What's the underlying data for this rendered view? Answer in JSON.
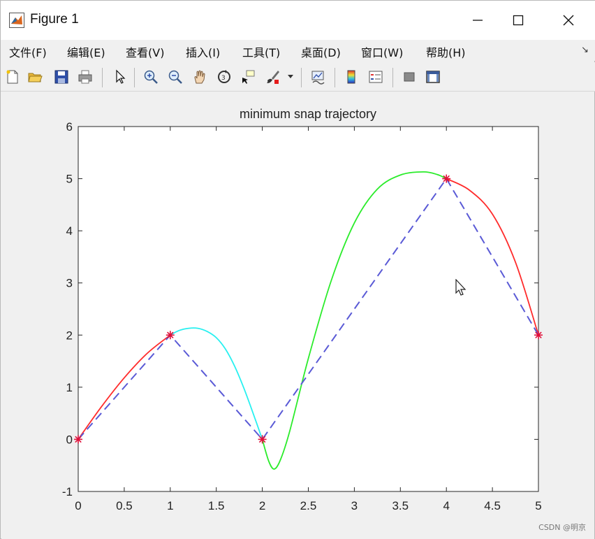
{
  "window": {
    "title": "Figure 1",
    "minimize_icon": "minimize-icon",
    "maximize_icon": "maximize-icon",
    "close_icon": "close-icon"
  },
  "menubar": {
    "items": [
      "文件(F)",
      "编辑(E)",
      "查看(V)",
      "插入(I)",
      "工具(T)",
      "桌面(D)",
      "窗口(W)",
      "帮助(H)"
    ],
    "dock_arrow": "↘"
  },
  "toolbar": {
    "buttons": [
      "new-figure-icon",
      "open-file-icon",
      "save-icon",
      "print-icon",
      "pointer-icon",
      "zoom-in-icon",
      "zoom-out-icon",
      "pan-hand-icon",
      "rotate-3d-icon",
      "data-cursor-icon",
      "brush-icon",
      "brush-dropdown-icon",
      "link-plot-icon",
      "colorbar-icon",
      "legend-icon",
      "hide-plot-tools-icon",
      "show-plot-tools-icon"
    ]
  },
  "colors": {
    "red_segment": "#ff2b2b",
    "cyan_segment": "#28f0f0",
    "green_segment": "#2bec2b",
    "dashed_line": "#5a5ad6",
    "waypoint_marker": "#e0103a"
  },
  "chart_data": {
    "type": "line",
    "title": "minimum snap trajectory",
    "xlim": [
      0,
      5
    ],
    "ylim": [
      -1,
      6
    ],
    "xticks": [
      "0",
      "0.5",
      "1",
      "1.5",
      "2",
      "2.5",
      "3",
      "3.5",
      "4",
      "4.5",
      "5"
    ],
    "yticks": [
      "-1",
      "0",
      "1",
      "2",
      "3",
      "4",
      "5",
      "6"
    ],
    "grid": false,
    "waypoints": {
      "x": [
        0,
        1,
        2,
        4,
        5
      ],
      "y": [
        0,
        2,
        0,
        5,
        2
      ]
    },
    "series": [
      {
        "color": "#ff2b2b",
        "style": "solid",
        "x": [
          0,
          0.25,
          0.5,
          0.75,
          1.0
        ],
        "y": [
          0,
          0.62,
          1.18,
          1.65,
          2.0
        ]
      },
      {
        "color": "#28f0f0",
        "style": "solid",
        "x": [
          1.0,
          1.1,
          1.2,
          1.3,
          1.4,
          1.5,
          1.6,
          1.7,
          1.8,
          1.9,
          2.0
        ],
        "y": [
          2.0,
          2.09,
          2.13,
          2.13,
          2.07,
          1.95,
          1.73,
          1.4,
          0.98,
          0.5,
          0.0
        ]
      },
      {
        "color": "#2bec2b",
        "style": "solid",
        "x": [
          2.0,
          2.07,
          2.13,
          2.2,
          2.3,
          2.5,
          2.75,
          3.0,
          3.25,
          3.5,
          3.75,
          3.9,
          4.0
        ],
        "y": [
          0.0,
          -0.42,
          -0.57,
          -0.38,
          0.17,
          1.55,
          3.05,
          4.15,
          4.8,
          5.07,
          5.13,
          5.08,
          5.0
        ]
      },
      {
        "color": "#ff2b2b",
        "style": "solid",
        "x": [
          4.0,
          4.25,
          4.5,
          4.75,
          5.0
        ],
        "y": [
          5.0,
          4.78,
          4.32,
          3.4,
          2.0
        ]
      },
      {
        "color": "#5a5ad6",
        "style": "dashed",
        "x": [
          0,
          1,
          2,
          4,
          5
        ],
        "y": [
          0,
          2,
          0,
          5,
          2
        ]
      }
    ]
  },
  "watermark": "CSDN @明京"
}
